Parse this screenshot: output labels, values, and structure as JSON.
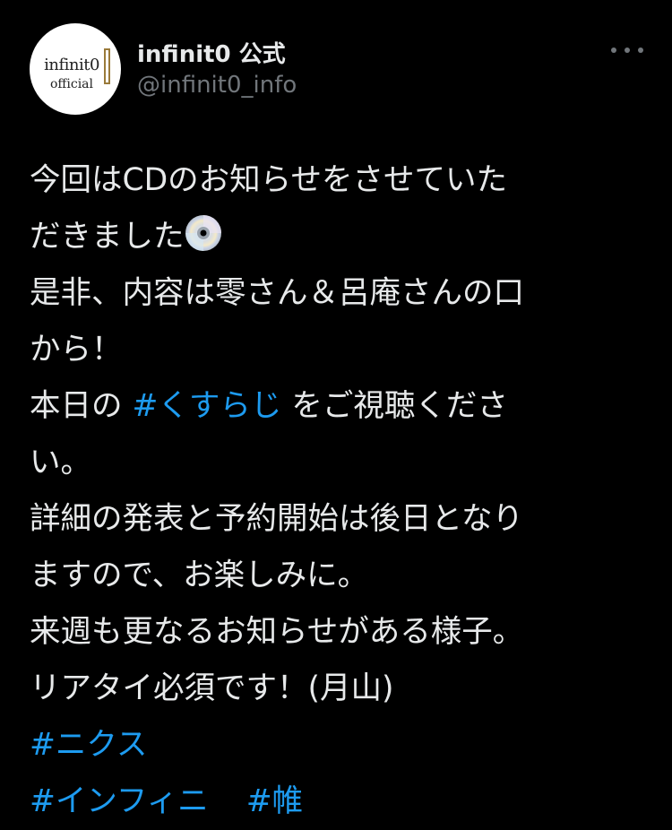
{
  "profile": {
    "avatar_text_top": "infinit0",
    "avatar_text_bottom": "official",
    "display_name": "infinit0 公式",
    "handle": "@infinit0_info"
  },
  "more_icon": "more-horizontal-icon",
  "tweet": {
    "line1": "今回はCDのお知らせをさせていた",
    "line2": "だきました",
    "line2_emoji": "cd-icon",
    "line3": "是非、内容は零さん＆呂庵さんの口",
    "line4": "から！",
    "line5_pre": "本日の ",
    "line5_hashtag": "#くすらじ",
    "line5_post": " をご視聴くださ",
    "line6": "い。",
    "line7": "詳細の発表と予約開始は後日となり",
    "line8": "ますので、お楽しみに。",
    "line9": "来週も更なるお知らせがある様子。",
    "line10": "リアタイ必須です！(月山)",
    "hashtag1": "#ニクス",
    "hashtag2": "#インフィニ",
    "hashtag3": "#帷"
  },
  "colors": {
    "background": "#000000",
    "text": "#e7e9ea",
    "secondary": "#71767b",
    "link": "#1d9bf0"
  }
}
